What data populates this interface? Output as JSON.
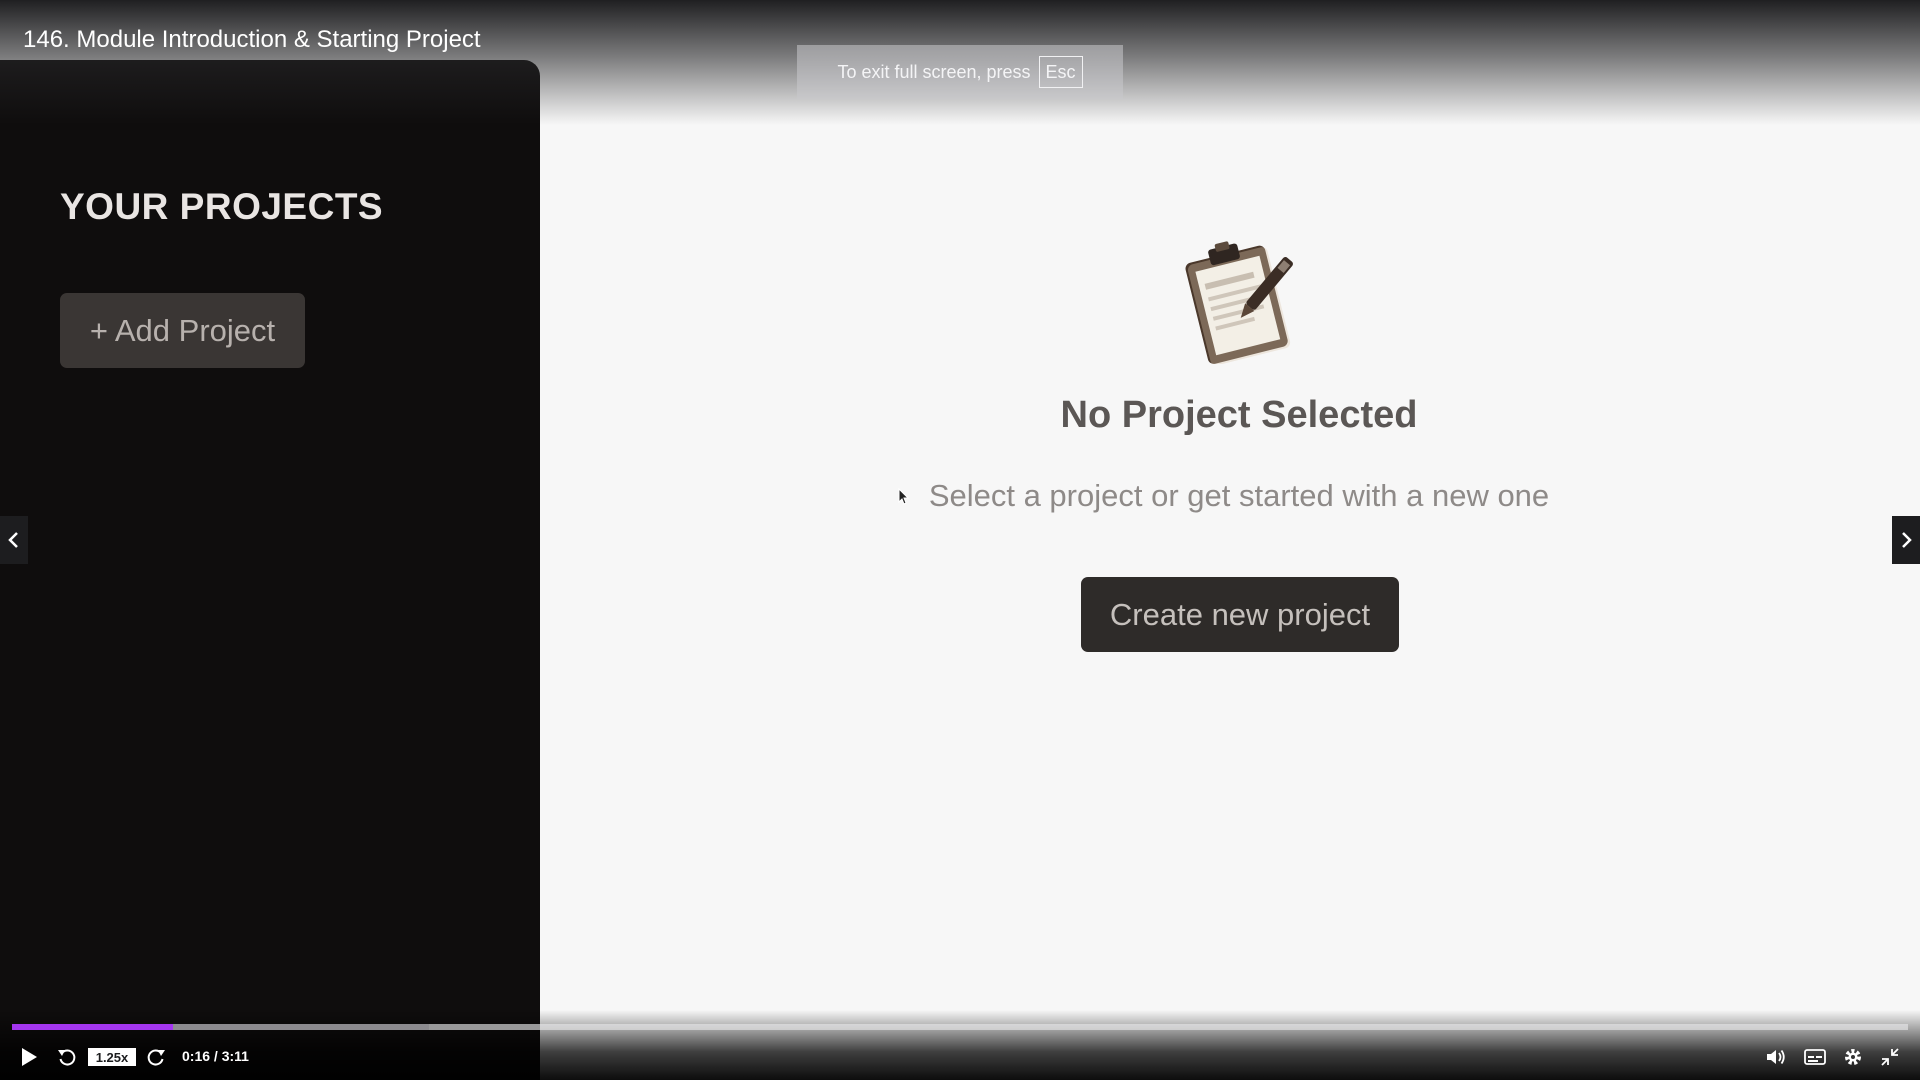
{
  "video": {
    "title": "146. Module Introduction & Starting Project",
    "fullscreen_notice": "To exit full screen, press",
    "esc_key": "Esc",
    "progress": {
      "played_fraction": 0.085,
      "buffered_fraction": 0.22
    },
    "speed": "1.25x",
    "time": "0:16 / 3:11",
    "accent_color": "#a435f0"
  },
  "app": {
    "sidebar": {
      "title": "YOUR PROJECTS",
      "add_button": "+ Add Project"
    },
    "empty_state": {
      "icon": "clipboard-icon",
      "title": "No Project Selected",
      "subtitle": "Select a project or get started with a new one",
      "button": "Create new project"
    }
  },
  "icons": {
    "play": "play-icon",
    "rewind": "rewind-icon",
    "forward": "forward-icon",
    "volume": "volume-icon",
    "captions": "captions-icon",
    "settings": "gear-icon",
    "exit_fullscreen": "exit-fullscreen-icon",
    "prev": "chevron-left-icon",
    "next": "chevron-right-icon"
  }
}
